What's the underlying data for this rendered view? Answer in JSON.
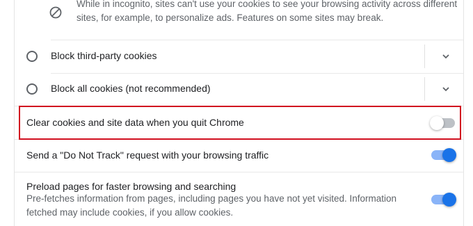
{
  "info": {
    "icon": "block-icon",
    "text": "While in incognito, sites can't use your cookies to see your browsing activity across different sites, for example, to personalize ads. Features on some sites may break."
  },
  "cookie_options": [
    {
      "label": "Block third-party cookies",
      "selected": false,
      "icon": "chevron-down-icon"
    },
    {
      "label": "Block all cookies (not recommended)",
      "selected": false,
      "icon": "chevron-down-icon"
    }
  ],
  "toggles": {
    "clear_on_quit": {
      "label": "Clear cookies and site data when you quit Chrome",
      "enabled": false
    },
    "do_not_track": {
      "label": "Send a \"Do Not Track\" request with your browsing traffic",
      "enabled": true
    },
    "preload": {
      "label": "Preload pages for faster browsing and searching",
      "description": "Pre-fetches information from pages, including pages you have not yet visited. Information fetched may include cookies, if you allow cookies.",
      "enabled": true
    }
  },
  "colors": {
    "highlight_border": "#d10f1f",
    "toggle_on": "#1a73e8",
    "toggle_on_track": "#8ab4f8",
    "toggle_off_track": "#bdc1c6"
  }
}
